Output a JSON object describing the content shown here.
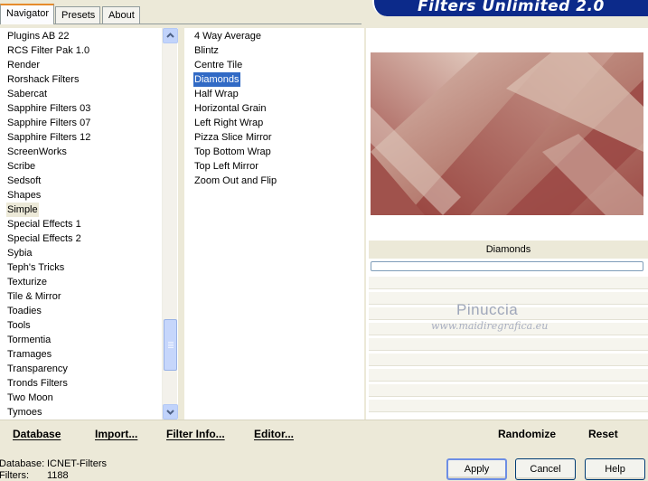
{
  "tabs": [
    {
      "label": "Navigator",
      "active": true
    },
    {
      "label": "Presets",
      "active": false
    },
    {
      "label": "About",
      "active": false
    }
  ],
  "banner": {
    "title": "Filters Unlimited 2.0"
  },
  "categories": {
    "items": [
      "Plugins AB 22",
      "RCS Filter Pak 1.0",
      "Render",
      "Rorshack Filters",
      "Sabercat",
      "Sapphire Filters 03",
      "Sapphire Filters 07",
      "Sapphire Filters 12",
      "ScreenWorks",
      "Scribe",
      "Sedsoft",
      "Shapes",
      "Simple",
      "Special Effects 1",
      "Special Effects 2",
      "Sybia",
      "Teph's Tricks",
      "Texturize",
      "Tile & Mirror",
      "Toadies",
      "Tools",
      "Tormentia",
      "Tramages",
      "Transparency",
      "Tronds Filters",
      "Two Moon",
      "Tymoes"
    ],
    "selected": "Simple"
  },
  "filters": {
    "items": [
      "4 Way Average",
      "Blintz",
      "Centre Tile",
      "Diamonds",
      "Half Wrap",
      "Horizontal Grain",
      "Left Right Wrap",
      "Pizza Slice Mirror",
      "Top Bottom Wrap",
      "Top Left Mirror",
      "Zoom Out and Flip"
    ],
    "selected": "Diamonds"
  },
  "preview": {
    "filter_name": "Diamonds",
    "colors": {
      "dark": "#9b4844",
      "light": "#dcc2b4",
      "mid": "#c29486"
    }
  },
  "watermark": {
    "name": "Pinuccia",
    "url": "www.maidiregrafica.eu"
  },
  "bottom_links": {
    "database": "Database",
    "import": "Import...",
    "filter_info": "Filter Info...",
    "editor": "Editor...",
    "randomize": "Randomize",
    "reset": "Reset"
  },
  "status": {
    "database_label": "Database:",
    "database_value": "ICNET-Filters",
    "filters_label": "Filters:",
    "filters_value": "1188"
  },
  "buttons": {
    "apply": "Apply",
    "cancel": "Cancel",
    "help": "Help"
  },
  "colors": {
    "selection": "#316ac5",
    "banner": "#0c2a8a",
    "face": "#ece9d8"
  }
}
